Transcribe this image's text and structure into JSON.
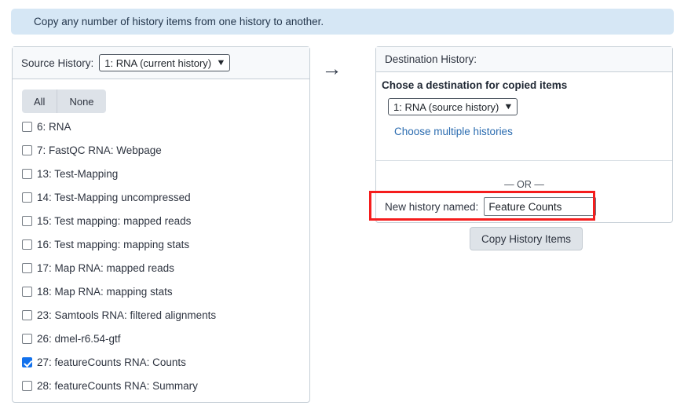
{
  "banner": {
    "text": "Copy any number of history items from one history to another."
  },
  "source": {
    "header_label": "Source History:",
    "selected_history": "1: RNA (current history)",
    "caret_icon": "chevron-down-icon",
    "select_all_label": "All",
    "select_none_label": "None",
    "items": [
      {
        "label": "6: RNA",
        "checked": false
      },
      {
        "label": "7: FastQC RNA: Webpage",
        "checked": false
      },
      {
        "label": "13: Test-Mapping",
        "checked": false
      },
      {
        "label": "14: Test-Mapping uncompressed",
        "checked": false
      },
      {
        "label": "15: Test mapping: mapped reads",
        "checked": false
      },
      {
        "label": "16: Test mapping: mapping stats",
        "checked": false
      },
      {
        "label": "17: Map RNA: mapped reads",
        "checked": false
      },
      {
        "label": "18: Map RNA: mapping stats",
        "checked": false
      },
      {
        "label": "23: Samtools RNA: filtered alignments",
        "checked": false
      },
      {
        "label": "26: dmel-r6.54-gtf",
        "checked": false
      },
      {
        "label": "27: featureCounts RNA: Counts",
        "checked": true
      },
      {
        "label": "28: featureCounts RNA: Summary",
        "checked": false
      }
    ]
  },
  "arrow": {
    "icon": "arrow-right-icon",
    "glyph": "→"
  },
  "destination": {
    "header_label": "Destination History:",
    "heading": "Chose a destination for copied items",
    "selected_history": "1: RNA (source history)",
    "caret_icon": "chevron-down-icon",
    "multiple_histories_link": "Choose multiple histories",
    "or_divider": "— OR —",
    "new_history_label": "New history named:",
    "new_history_value": "Feature Counts",
    "new_history_placeholder": ""
  },
  "actions": {
    "copy_button_label": "Copy History Items"
  },
  "colors": {
    "banner_background": "#d6e7f5",
    "checkbox_checked": "#1271ec",
    "link": "#2b6cb0",
    "highlight_outline": "#f51d1d",
    "panel_border": "#c5ced6",
    "button_background": "#dee3e8"
  }
}
